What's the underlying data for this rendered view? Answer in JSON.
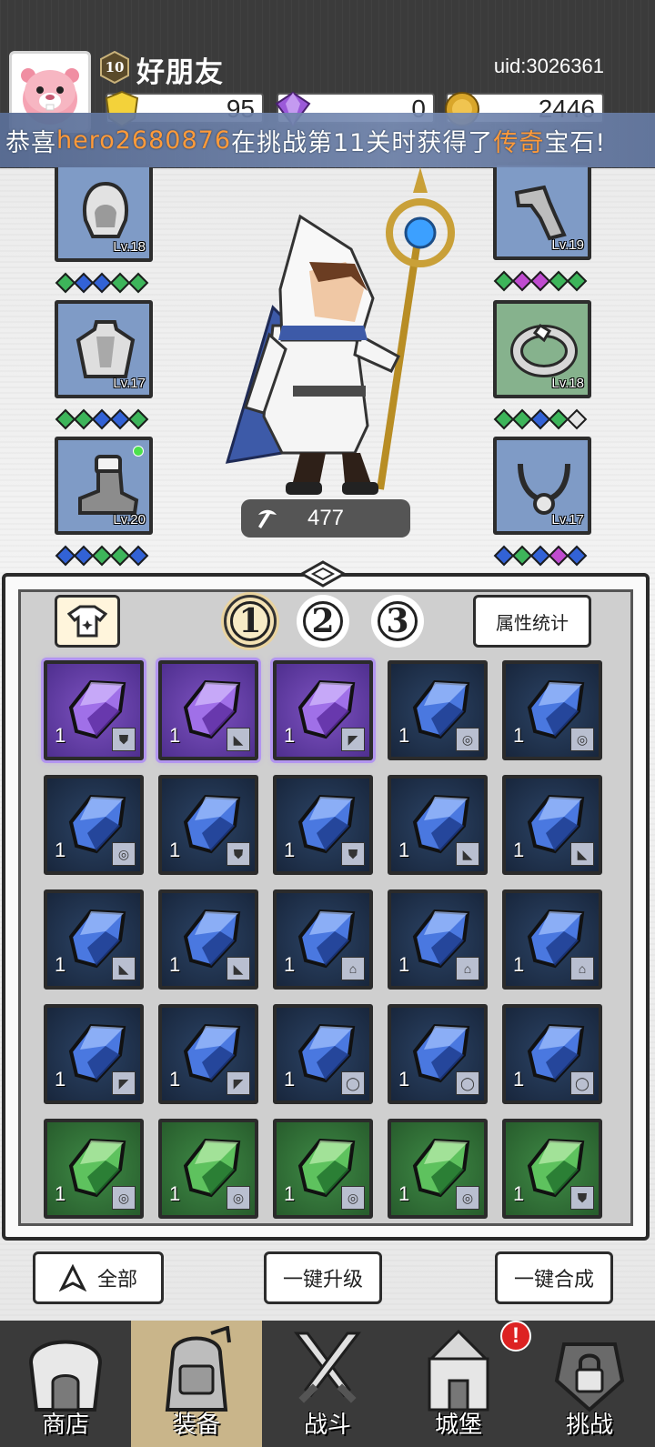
{
  "header": {
    "level": "10",
    "username": "好朋友",
    "uid": "uid:3026361",
    "currencies": [
      {
        "name": "gold-shield",
        "value": "95",
        "color": "#f3d23a"
      },
      {
        "name": "purple-gem",
        "value": "0",
        "color": "#9b59d9"
      },
      {
        "name": "coin",
        "value": "2446",
        "color": "#d9a62a"
      }
    ]
  },
  "broadcast": {
    "prefix": "恭喜",
    "player": "hero2680876",
    "middle": "在挑战第11关时获得了",
    "rarity": "传奇",
    "suffix": "宝石!"
  },
  "equipment": {
    "left": [
      {
        "slot": "hood",
        "level": "Lv.18",
        "gems": [
          "green",
          "blue",
          "blue",
          "green",
          "green"
        ]
      },
      {
        "slot": "cloak",
        "level": "Lv.17",
        "gems": [
          "green",
          "green",
          "blue",
          "blue",
          "green"
        ]
      },
      {
        "slot": "boots",
        "level": "Lv.20",
        "gems": [
          "blue",
          "blue",
          "green",
          "green",
          "blue"
        ]
      }
    ],
    "right": [
      {
        "slot": "bracer",
        "level": "Lv.19",
        "gems": [
          "green",
          "purple",
          "purple",
          "green",
          "green"
        ]
      },
      {
        "slot": "ring",
        "level": "Lv.18",
        "gems": [
          "green",
          "green",
          "blue",
          "green",
          "white"
        ]
      },
      {
        "slot": "necklace",
        "level": "Lv.17",
        "gems": [
          "blue",
          "green",
          "blue",
          "purple",
          "blue"
        ]
      }
    ]
  },
  "hero": {
    "power": "477"
  },
  "inventory": {
    "pages": [
      "1",
      "2",
      "3"
    ],
    "active_page": "1",
    "stats_label": "属性统计",
    "items": [
      {
        "rarity": "purple",
        "count": "1",
        "slot_icon": "cloak"
      },
      {
        "rarity": "purple",
        "count": "1",
        "slot_icon": "boots"
      },
      {
        "rarity": "purple",
        "count": "1",
        "slot_icon": "bracer"
      },
      {
        "rarity": "blue",
        "count": "1",
        "slot_icon": "ring"
      },
      {
        "rarity": "blue",
        "count": "1",
        "slot_icon": "ring"
      },
      {
        "rarity": "blue",
        "count": "1",
        "slot_icon": "ring"
      },
      {
        "rarity": "blue",
        "count": "1",
        "slot_icon": "cloak"
      },
      {
        "rarity": "blue",
        "count": "1",
        "slot_icon": "cloak"
      },
      {
        "rarity": "blue",
        "count": "1",
        "slot_icon": "boots"
      },
      {
        "rarity": "blue",
        "count": "1",
        "slot_icon": "boots"
      },
      {
        "rarity": "blue",
        "count": "1",
        "slot_icon": "boots"
      },
      {
        "rarity": "blue",
        "count": "1",
        "slot_icon": "boots"
      },
      {
        "rarity": "blue",
        "count": "1",
        "slot_icon": "hood"
      },
      {
        "rarity": "blue",
        "count": "1",
        "slot_icon": "hood"
      },
      {
        "rarity": "blue",
        "count": "1",
        "slot_icon": "hood"
      },
      {
        "rarity": "blue",
        "count": "1",
        "slot_icon": "bracer"
      },
      {
        "rarity": "blue",
        "count": "1",
        "slot_icon": "bracer"
      },
      {
        "rarity": "blue",
        "count": "1",
        "slot_icon": "necklace"
      },
      {
        "rarity": "blue",
        "count": "1",
        "slot_icon": "necklace"
      },
      {
        "rarity": "blue",
        "count": "1",
        "slot_icon": "necklace"
      },
      {
        "rarity": "green",
        "count": "1",
        "slot_icon": "ring"
      },
      {
        "rarity": "green",
        "count": "1",
        "slot_icon": "ring"
      },
      {
        "rarity": "green",
        "count": "1",
        "slot_icon": "ring"
      },
      {
        "rarity": "green",
        "count": "1",
        "slot_icon": "ring"
      },
      {
        "rarity": "green",
        "count": "1",
        "slot_icon": "cloak"
      }
    ]
  },
  "actions": {
    "filter_all": "全部",
    "upgrade_all": "一键升级",
    "merge_all": "一键合成"
  },
  "nav": [
    {
      "label": "商店",
      "icon": "shop-icon"
    },
    {
      "label": "装备",
      "icon": "backpack-icon",
      "active": true
    },
    {
      "label": "战斗",
      "icon": "swords-icon"
    },
    {
      "label": "城堡",
      "icon": "castle-icon"
    },
    {
      "label": "挑战",
      "icon": "lock-helmet-icon"
    }
  ],
  "alert_badge": "!"
}
